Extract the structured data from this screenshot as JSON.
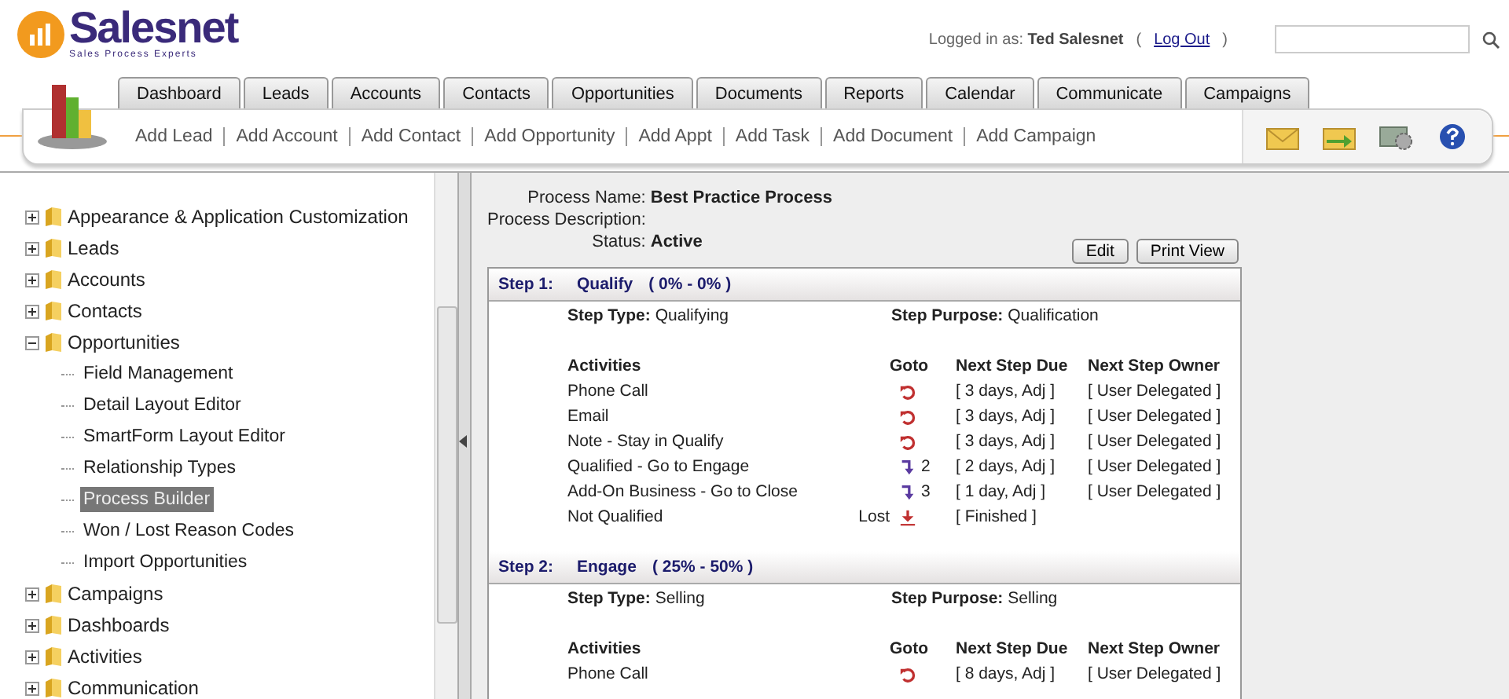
{
  "brand": {
    "name": "Salesnet",
    "tagline": "Sales Process Experts"
  },
  "session": {
    "label": "Logged in as:",
    "user": "Ted Salesnet",
    "paren_open": "(",
    "logout": "Log Out",
    "paren_close": ")"
  },
  "tabs": [
    {
      "label": "Dashboard",
      "selected": false
    },
    {
      "label": "Leads",
      "selected": false
    },
    {
      "label": "Accounts",
      "selected": false
    },
    {
      "label": "Contacts",
      "selected": false
    },
    {
      "label": "Opportunities",
      "selected": false
    },
    {
      "label": "Documents",
      "selected": false
    },
    {
      "label": "Reports",
      "selected": false
    },
    {
      "label": "Calendar",
      "selected": false
    },
    {
      "label": "Communicate",
      "selected": false
    },
    {
      "label": "Campaigns",
      "selected": false
    }
  ],
  "quick_links": [
    "Add Lead",
    "Add Account",
    "Add Contact",
    "Add Opportunity",
    "Add Appt",
    "Add Task",
    "Add Document",
    "Add Campaign"
  ],
  "tree": [
    {
      "label": "Appearance & Application Customization",
      "expanded": false
    },
    {
      "label": "Leads",
      "expanded": false
    },
    {
      "label": "Accounts",
      "expanded": false
    },
    {
      "label": "Contacts",
      "expanded": false
    },
    {
      "label": "Opportunities",
      "expanded": true,
      "children": [
        {
          "label": "Field Management",
          "selected": false
        },
        {
          "label": "Detail Layout Editor",
          "selected": false
        },
        {
          "label": "SmartForm Layout Editor",
          "selected": false
        },
        {
          "label": "Relationship Types",
          "selected": false
        },
        {
          "label": "Process Builder",
          "selected": true
        },
        {
          "label": "Won / Lost Reason Codes",
          "selected": false
        },
        {
          "label": "Import Opportunities",
          "selected": false
        }
      ]
    },
    {
      "label": "Campaigns",
      "expanded": false
    },
    {
      "label": "Dashboards",
      "expanded": false
    },
    {
      "label": "Activities",
      "expanded": false
    },
    {
      "label": "Communication",
      "expanded": false
    }
  ],
  "process": {
    "name_label": "Process Name:",
    "name": "Best Practice Process",
    "description_label": "Process Description:",
    "status_label": "Status:",
    "status": "Active"
  },
  "buttons": [
    "Edit",
    "Print View"
  ],
  "steps": [
    {
      "number": "Step 1:",
      "name": "Qualify",
      "range": "( 0% - 0% )",
      "type_label": "Step Type:",
      "type": "Qualifying",
      "purpose_label": "Step Purpose:",
      "purpose": "Qualification",
      "columns": [
        "Activities",
        "Goto",
        "Next Step Due",
        "Next Step Owner"
      ],
      "activities": [
        {
          "name": "Phone Call",
          "kind": "repeat",
          "due": "[ 3 days, Adj ]",
          "owner": "[ User Delegated ]"
        },
        {
          "name": "Email",
          "kind": "repeat",
          "due": "[ 3 days, Adj ]",
          "owner": "[ User Delegated ]"
        },
        {
          "name": "Note - Stay in Qualify",
          "kind": "repeat",
          "due": "[ 3 days, Adj ]",
          "owner": "[ User Delegated ]"
        },
        {
          "name": "Qualified - Go to Engage",
          "kind": "step",
          "goto_step": "2",
          "due": "[ 2 days, Adj ]",
          "owner": "[ User Delegated ]"
        },
        {
          "name": "Add-On Business - Go to Close",
          "kind": "step",
          "goto_step": "3",
          "due": "[ 1 day, Adj ]",
          "owner": "[ User Delegated ]"
        },
        {
          "name": "Not Qualified",
          "outcome": "Lost",
          "kind": "finish",
          "due": "[ Finished ]"
        }
      ]
    },
    {
      "number": "Step 2:",
      "name": "Engage",
      "range": "( 25% - 50% )",
      "type_label": "Step Type:",
      "type": "Selling",
      "purpose_label": "Step Purpose:",
      "purpose": "Selling",
      "columns": [
        "Activities",
        "Goto",
        "Next Step Due",
        "Next Step Owner"
      ],
      "activities": [
        {
          "name": "Phone Call",
          "kind": "repeat",
          "due": "[ 8 days, Adj ]",
          "owner": "[ User Delegated ]"
        }
      ]
    }
  ]
}
